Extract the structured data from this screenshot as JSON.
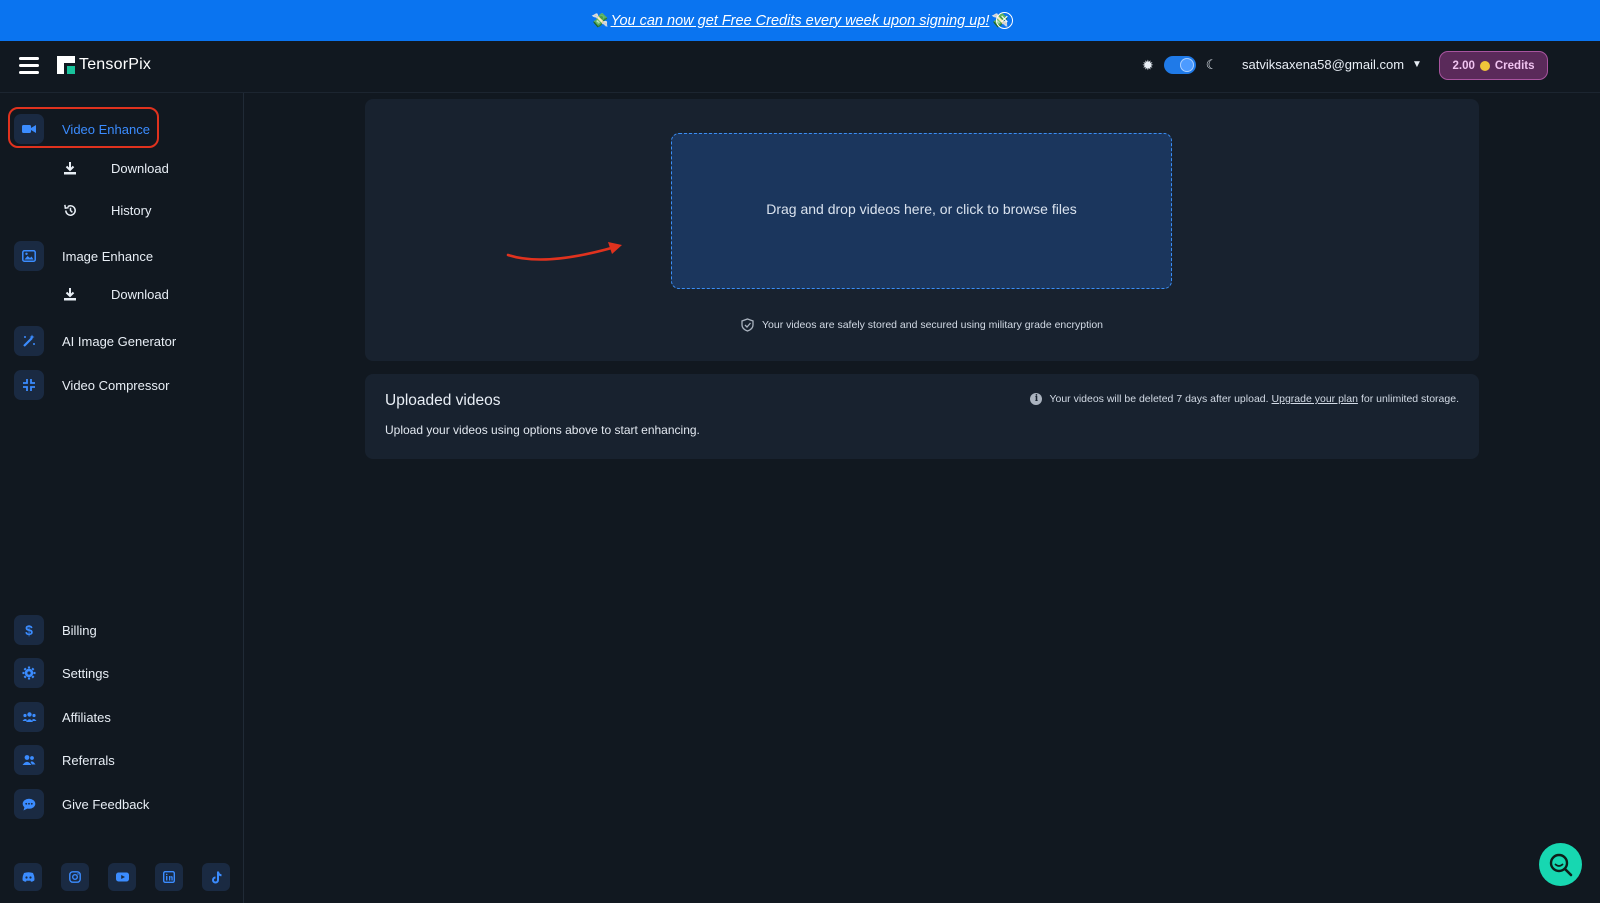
{
  "promo": {
    "emoji_left": "💸",
    "text": "You can now get Free Credits every week upon signing up!",
    "emoji_right": "💸",
    "close": "✕"
  },
  "header": {
    "brand": "TensorPix",
    "account_email": "satviksaxena58@gmail.com",
    "credits_value": "2.00",
    "credits_label": "Credits",
    "dark_mode": true
  },
  "sidebar": {
    "items": [
      {
        "label": "Video Enhance",
        "icon": "video-camera-icon",
        "active": true
      },
      {
        "label": "Download",
        "icon": "download-icon"
      },
      {
        "label": "History",
        "icon": "history-icon"
      },
      {
        "label": "Image Enhance",
        "icon": "image-icon"
      },
      {
        "label": "Download",
        "icon": "download-icon"
      },
      {
        "label": "AI Image Generator",
        "icon": "magic-wand-icon"
      },
      {
        "label": "Video Compressor",
        "icon": "compress-icon"
      }
    ],
    "bottom_items": [
      {
        "label": "Billing",
        "icon": "dollar-icon"
      },
      {
        "label": "Settings",
        "icon": "gear-icon"
      },
      {
        "label": "Affiliates",
        "icon": "users-icon"
      },
      {
        "label": "Referrals",
        "icon": "user-group-icon"
      },
      {
        "label": "Give Feedback",
        "icon": "chat-bubble-icon"
      }
    ],
    "socials": [
      "discord-icon",
      "instagram-icon",
      "youtube-icon",
      "linkedin-icon",
      "tiktok-icon"
    ]
  },
  "upload": {
    "dropzone_text": "Drag and drop videos here, or click to browse files",
    "secure_text": "Your videos are safely stored and secured using military grade encryption"
  },
  "uploaded": {
    "title": "Uploaded videos",
    "empty_text": "Upload your videos using options above to start enhancing.",
    "notice_before": "Your videos will be deleted 7 days after upload.",
    "notice_link": "Upgrade your plan",
    "notice_after": "for unlimited storage."
  },
  "colors": {
    "accent": "#3b8cff",
    "promo_bg": "#0a74f0",
    "credits_bg": "#5a2a5a",
    "annotation": "#e0321e",
    "chat": "#17d7b1"
  }
}
